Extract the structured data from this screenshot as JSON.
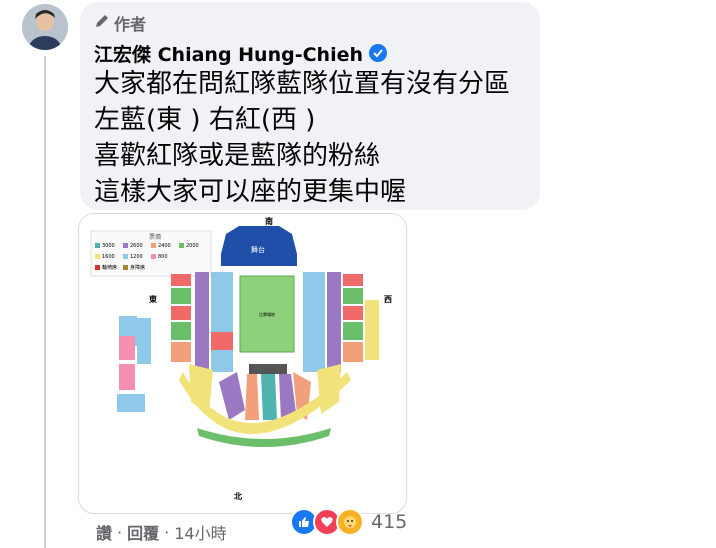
{
  "comment": {
    "badge_label": "作者",
    "author_name": "江宏傑 Chiang Hung-Chieh",
    "lines": [
      "大家都在問紅隊藍隊位置有沒有分區",
      "左藍(東 )  右紅(西 )",
      "喜歡紅隊或是藍隊的粉絲",
      "這樣大家可以座的更集中喔"
    ]
  },
  "seat_map": {
    "compass": {
      "south": "南",
      "east": "東",
      "west": "西",
      "north": "北"
    },
    "stage_label": "舞台",
    "court_label": "比賽場地",
    "legend_title": "票價",
    "legend": [
      {
        "label": "3000",
        "color": "#4fb3b0"
      },
      {
        "label": "2600",
        "color": "#9b79c2"
      },
      {
        "label": "2400",
        "color": "#f2a07b"
      },
      {
        "label": "2000",
        "color": "#6cbf6a"
      },
      {
        "label": "1600",
        "color": "#f2e27a"
      },
      {
        "label": "1200",
        "color": "#8fc9ea"
      },
      {
        "label": "800",
        "color": "#f48fb1"
      }
    ],
    "legend_extra": [
      {
        "label": "輪椅席",
        "color": "#d9302c"
      },
      {
        "label": "身障席",
        "color": "#a3862f"
      }
    ]
  },
  "actions": {
    "like": "讚",
    "reply": "回覆",
    "time": "14小時",
    "separator": "·"
  },
  "reactions": {
    "count": "415",
    "types": [
      "like-icon",
      "love-icon",
      "care-icon"
    ],
    "colors": {
      "like": "#1877f2",
      "love": "#f33e58",
      "care": "#f7b125"
    }
  }
}
